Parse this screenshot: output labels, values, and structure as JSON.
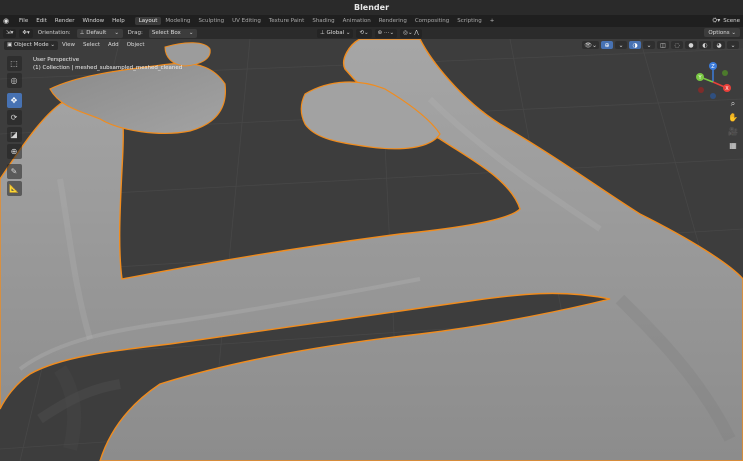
{
  "window": {
    "title": "Blender"
  },
  "menubar": {
    "menus": [
      "File",
      "Edit",
      "Render",
      "Window",
      "Help"
    ],
    "workspaces": [
      "Layout",
      "Modeling",
      "Sculpting",
      "UV Editing",
      "Texture Paint",
      "Shading",
      "Animation",
      "Rendering",
      "Compositing",
      "Scripting"
    ],
    "active_workspace": "Layout",
    "add_tab": "+",
    "scene_label": "Scene"
  },
  "toolheader": {
    "orientation_label": "Orientation:",
    "orientation_value": "Default",
    "drag_label": "Drag:",
    "drag_value": "Select Box",
    "transform_orientation": "Global",
    "options_label": "Options"
  },
  "viewport_header": {
    "mode": "Object Mode",
    "menus": [
      "View",
      "Select",
      "Add",
      "Object"
    ]
  },
  "viewport_info": {
    "line1": "User Perspective",
    "line2": "(1) Collection | meshed_subsampled_meshed_cleaned"
  },
  "gizmo": {
    "x_label": "X",
    "y_label": "Y",
    "z_label": "Z"
  },
  "colors": {
    "accent": "#4772b3",
    "selection_outline": "#f08c1e",
    "mesh_surface": "#9a9a9a",
    "grid_background": "#3d3d3d",
    "axis_x": "#e8403a",
    "axis_y": "#7ac943",
    "axis_z": "#3c7cdb"
  }
}
